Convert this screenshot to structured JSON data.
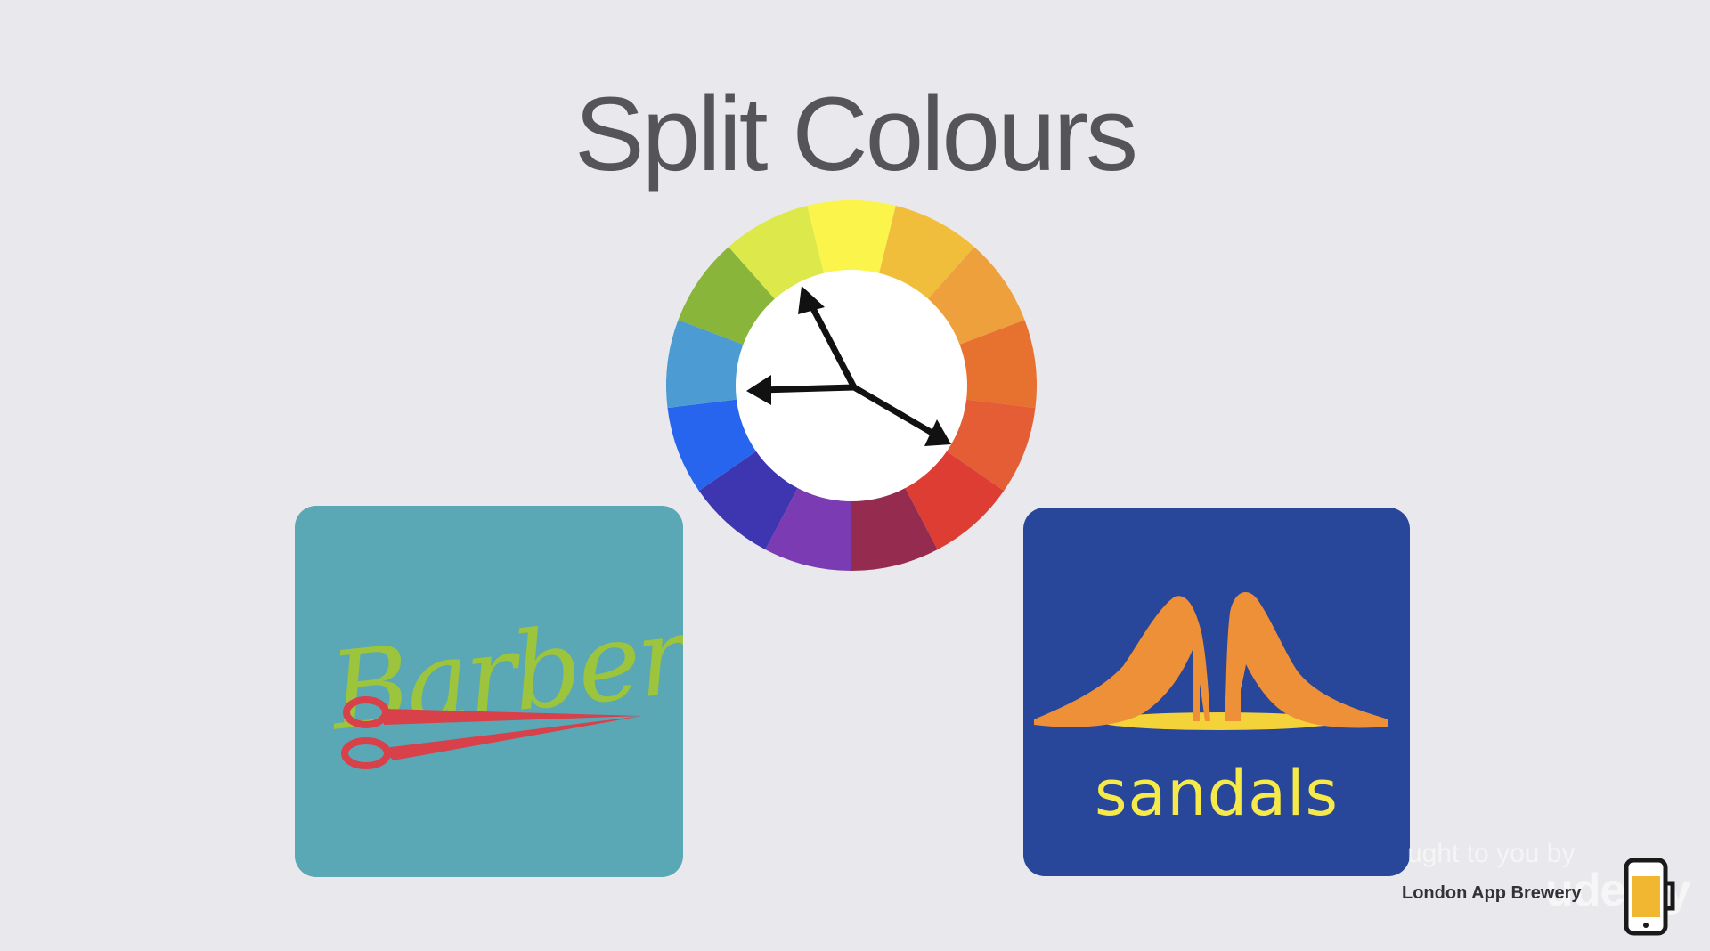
{
  "slide": {
    "title": "Split Colours",
    "background": "#e9e8ec"
  },
  "color_wheel": {
    "icon": "color-wheel-icon",
    "segments": [
      "#fbf44a",
      "#f1be3c",
      "#eea03c",
      "#e7712f",
      "#e45d34",
      "#de3d34",
      "#952c4f",
      "#7b3bb2",
      "#3e35b1",
      "#2765ef",
      "#4c9bd2",
      "#89b53a",
      "#dde84a"
    ],
    "arrows": "split-complementary-arrows-icon"
  },
  "tiles": {
    "barber": {
      "background": "#5aa7b5",
      "word": "Barber",
      "word_color": "#9cc43c",
      "icon": "scissors-icon",
      "icon_color": "#d8404a"
    },
    "sandals": {
      "background": "#28469a",
      "word": "sandals",
      "word_color": "#f6e94a",
      "icon": "high-heels-icon",
      "icon_color": "#ee9038"
    }
  },
  "credit": {
    "upper": "ught to you by",
    "lower": "London App Brewery",
    "wordmark": "udemy",
    "icon": "beer-phone-icon"
  }
}
